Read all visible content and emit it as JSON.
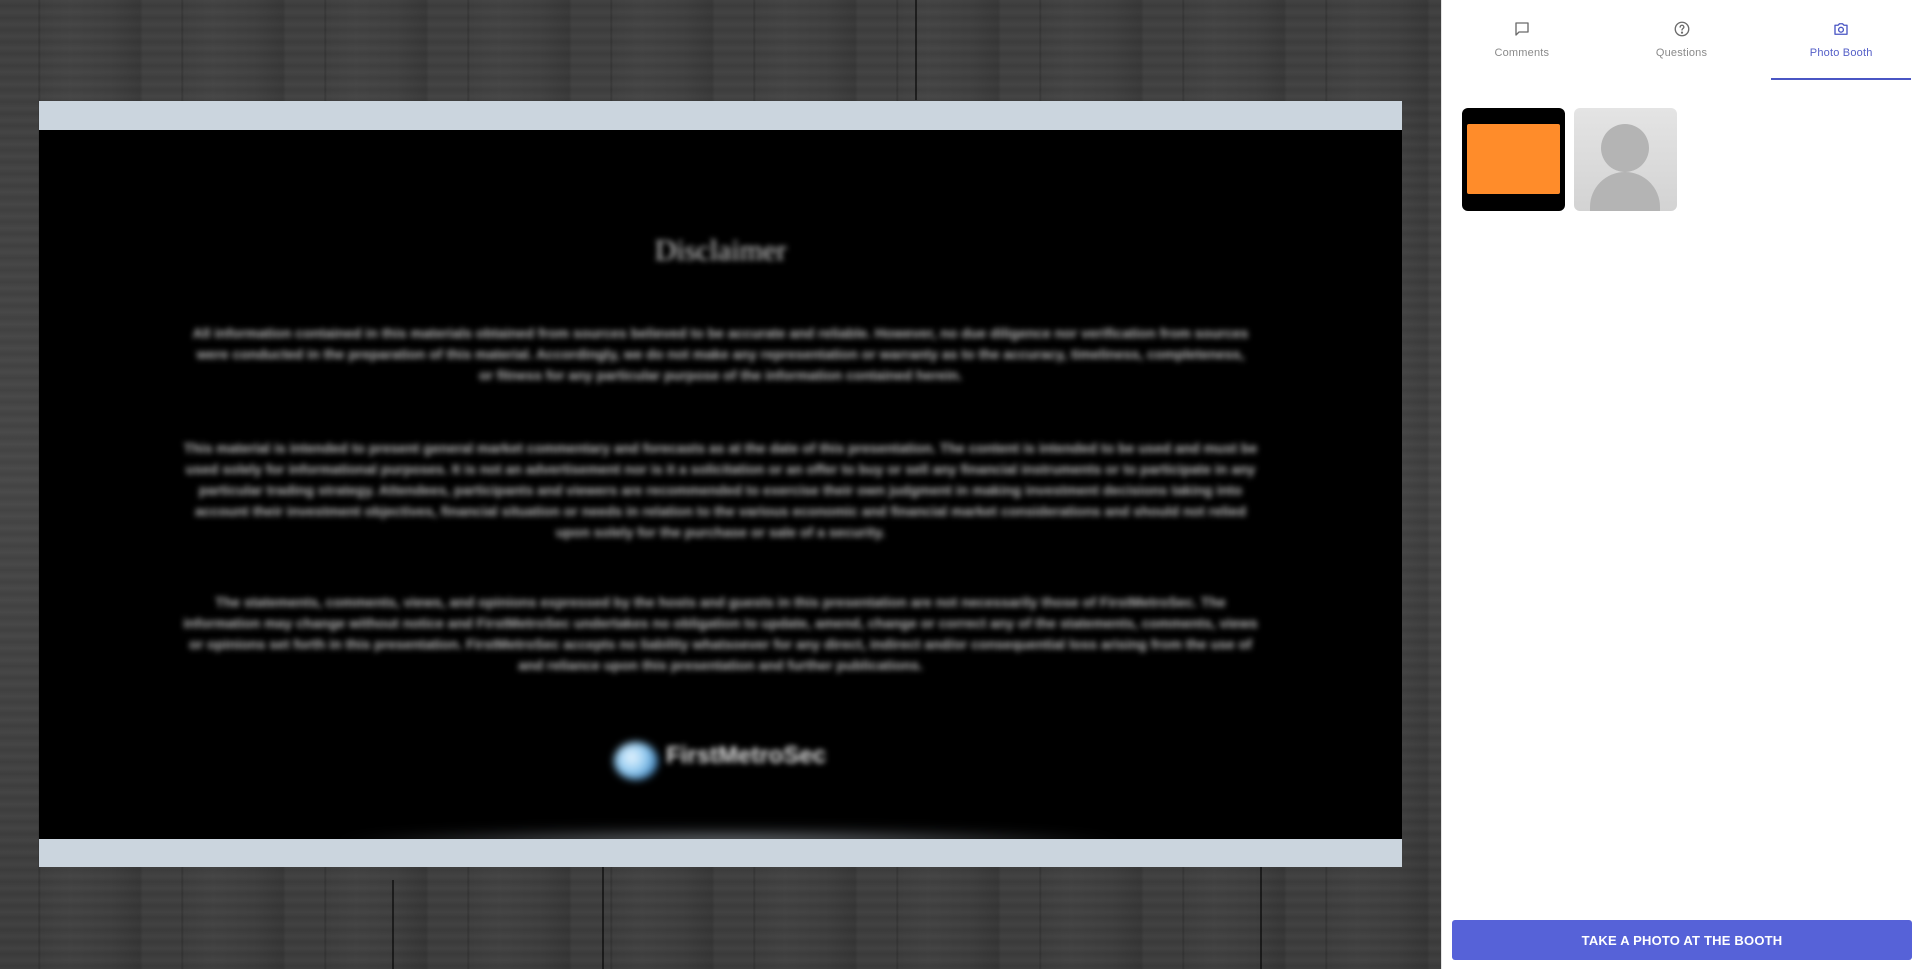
{
  "tabs": [
    {
      "label": "Comments",
      "icon": "comment-icon",
      "active": false
    },
    {
      "label": "Questions",
      "icon": "question-icon",
      "active": false
    },
    {
      "label": "Photo Booth",
      "icon": "camera-icon",
      "active": true
    }
  ],
  "slide": {
    "title": "Disclaimer",
    "paragraphs": [
      "All information contained in this materials obtained from sources believed to be accurate and reliable. However, no due diligence nor verification from sources were conducted in the preparation of this material. Accordingly, we do not make any representation or warranty as to the accuracy, timeliness, completeness, or fitness for any particular purpose of the information contained herein.",
      "This material is intended to present general market commentary and forecasts as at the date of this presentation. The content is intended to be used and must be used solely for informational purposes. It is not an advertisement nor is it a solicitation or an offer to buy or sell any financial instruments or to participate in any particular trading strategy. Attendees, participants and viewers are recommended to exercise their own judgment in making investment decisions taking into account their investment objectives, financial situation or needs in relation to the various economic and financial market considerations and should not relied upon solely for the purchase or sale of a security.",
      "The statements, comments, views, and opinions expressed by the hosts and guests in this presentation are not necessarily those of FirstMetroSec. The information may change without notice and FirstMetroSec undertakes no obligation to update, amend, change or correct any of the statements, comments, views or opinions set forth in this presentation. FirstMetroSec accepts no liability whatsoever for any direct, indirect and/or consequential loss arising from the use of and reliance upon this presentation and further publications."
    ],
    "logo_text": "FirstMetroSec"
  },
  "photos": [
    {
      "type": "slide-snapshot",
      "accent": "#ff8c2a"
    },
    {
      "type": "avatar-placeholder"
    }
  ],
  "cta": {
    "label": "TAKE A PHOTO AT THE BOOTH"
  },
  "colors": {
    "accent": "#5662d8",
    "tab_active": "#4a56c4",
    "slide_frame": "#cbd5de"
  }
}
